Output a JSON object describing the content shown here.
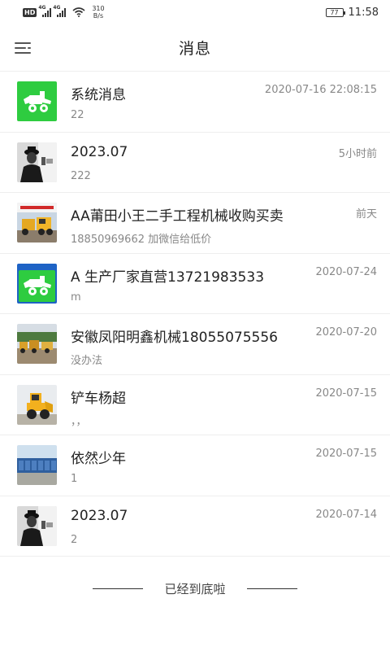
{
  "status_bar": {
    "hd": "HD",
    "net_tag_1": "4G",
    "net_tag_2": "4G",
    "net_speed_value": "310",
    "net_speed_unit": "B/s",
    "battery": "77",
    "time": "11:58"
  },
  "header": {
    "title": "消息"
  },
  "messages": [
    {
      "title": "系统消息",
      "subtitle": "22",
      "time": "2020-07-16 22:08:15",
      "avatar": "loader-logo-icon"
    },
    {
      "title": "2023.07",
      "subtitle": "222",
      "time": "5小时前",
      "avatar": "person-photo"
    },
    {
      "title": "AA莆田小王二手工程机械收购买卖",
      "subtitle": "18850969662 加微信给低价",
      "time": "前天",
      "avatar": "excavator-banner-photo"
    },
    {
      "title": "A 生产厂家直营13721983533",
      "subtitle": "m",
      "time": "2020-07-24",
      "avatar": "loader-parts-logo-icon"
    },
    {
      "title": "安徽凤阳明鑫机械18055075556",
      "subtitle": "没办法",
      "time": "2020-07-20",
      "avatar": "machinery-yard-photo"
    },
    {
      "title": "铲车杨超",
      "subtitle": "，，",
      "time": "2020-07-15",
      "avatar": "yellow-loader-photo"
    },
    {
      "title": "依然少年",
      "subtitle": "1",
      "time": "2020-07-15",
      "avatar": "building-photo"
    },
    {
      "title": "2023.07",
      "subtitle": "2",
      "time": "2020-07-14",
      "avatar": "person-photo"
    }
  ],
  "footer": {
    "end_text": "已经到底啦"
  },
  "colors": {
    "accent_green": "#2ecc40",
    "divider": "#eeeeee",
    "text_secondary": "#888888"
  }
}
